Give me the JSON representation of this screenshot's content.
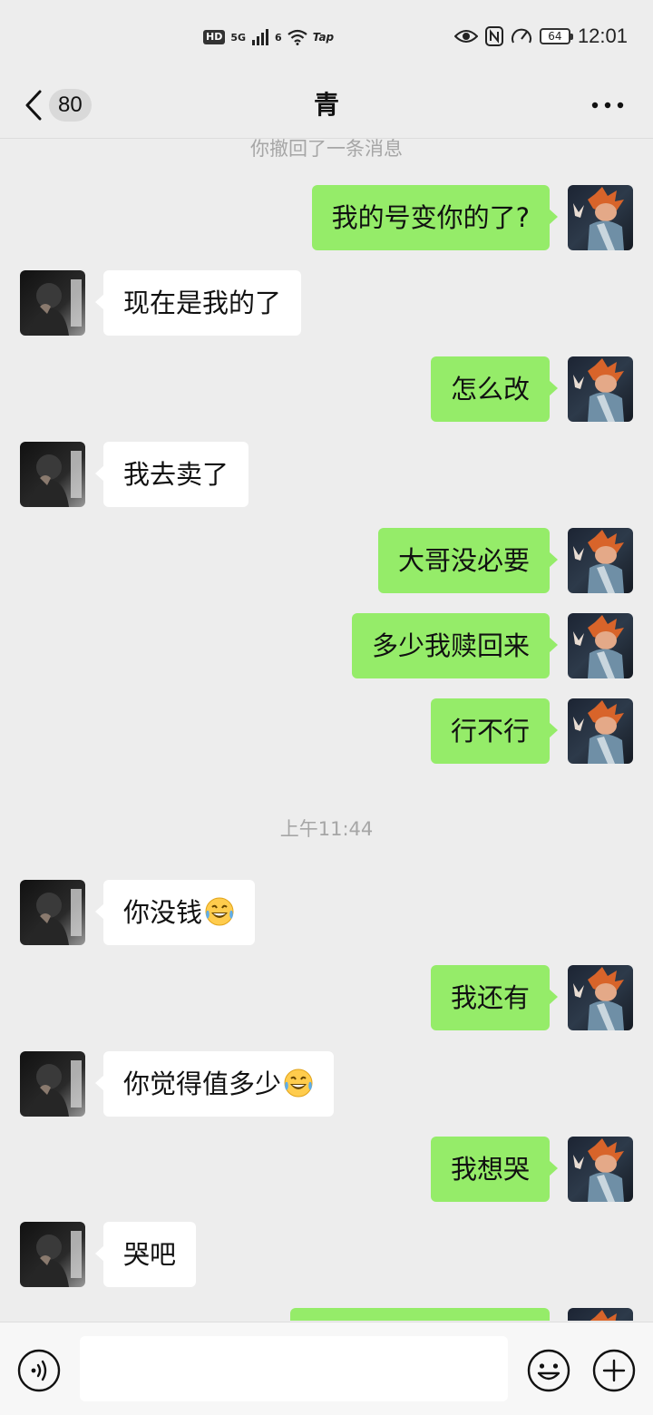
{
  "status_bar": {
    "hd": "HD",
    "net1": "5G",
    "net2": "6",
    "tap": "Tap",
    "battery": "64",
    "time": "12:01"
  },
  "header": {
    "unread_count": "80",
    "title": "青",
    "icons": {
      "back": "chevron-left-icon",
      "more": "more-dots-icon"
    }
  },
  "chat": {
    "recall_notice": "你撤回了一条消息",
    "timestamp": "上午11:44",
    "messages": [
      {
        "sender": "self",
        "text": "我的号变你的了?"
      },
      {
        "sender": "other",
        "text": "现在是我的了"
      },
      {
        "sender": "self",
        "text": "怎么改"
      },
      {
        "sender": "other",
        "text": "我去卖了"
      },
      {
        "sender": "self",
        "text": "大哥没必要"
      },
      {
        "sender": "self",
        "text": "多少我赎回来"
      },
      {
        "sender": "self",
        "text": "行不行"
      },
      {
        "sender": "other",
        "text": "你没钱",
        "emoji": "tears-of-joy-emoji"
      },
      {
        "sender": "self",
        "text": "我还有"
      },
      {
        "sender": "other",
        "text": "你觉得值多少",
        "emoji": "tears-of-joy-emoji"
      },
      {
        "sender": "self",
        "text": "我想哭"
      },
      {
        "sender": "other",
        "text": "哭吧"
      }
    ]
  },
  "input_bar": {
    "value": "",
    "icons": {
      "voice": "voice-icon",
      "emoji": "emoji-icon",
      "plus": "plus-icon"
    }
  },
  "colors": {
    "background": "#ededed",
    "self_bubble": "#95ec69",
    "other_bubble": "#ffffff"
  }
}
